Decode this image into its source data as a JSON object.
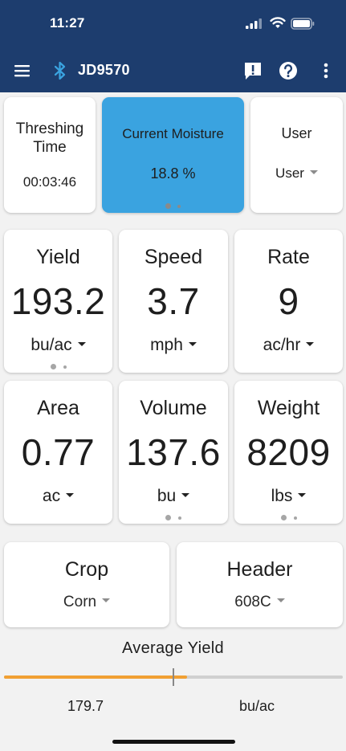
{
  "status_bar": {
    "time": "11:27"
  },
  "app_bar": {
    "title": "JD9570"
  },
  "top_cards": {
    "threshing": {
      "label": "Threshing Time",
      "value": "00:03:46"
    },
    "moisture": {
      "label": "Current Moisture",
      "value": "18.8 %",
      "page_dots": 2,
      "active_dot": 1
    },
    "user": {
      "label": "User",
      "value": "User"
    }
  },
  "metrics": [
    {
      "label": "Yield",
      "value": "193.2",
      "unit": "bu/ac",
      "page_dots": 2
    },
    {
      "label": "Speed",
      "value": "3.7",
      "unit": "mph"
    },
    {
      "label": "Rate",
      "value": "9",
      "unit": "ac/hr"
    },
    {
      "label": "Area",
      "value": "0.77",
      "unit": "ac"
    },
    {
      "label": "Volume",
      "value": "137.6",
      "unit": "bu",
      "page_dots": 2
    },
    {
      "label": "Weight",
      "value": "8209",
      "unit": "lbs",
      "page_dots": 2
    }
  ],
  "selectors": {
    "crop": {
      "label": "Crop",
      "value": "Corn"
    },
    "header": {
      "label": "Header",
      "value": "608C"
    }
  },
  "average_yield": {
    "title": "Average Yield",
    "value": "179.7",
    "unit": "bu/ac",
    "bar_fill_fraction": 0.54,
    "marker_fraction": 0.5
  },
  "colors": {
    "top_bar": "#1d3d6e",
    "moisture_card": "#3aa3e0",
    "progress_fill": "#f1a033",
    "background": "#f2f2f2"
  },
  "icons": {
    "menu": "menu-icon",
    "bluetooth": "bluetooth-icon",
    "alert": "alert-icon",
    "help": "help-icon",
    "more": "more-vertical-icon",
    "dropdown": "caret-down-icon"
  }
}
